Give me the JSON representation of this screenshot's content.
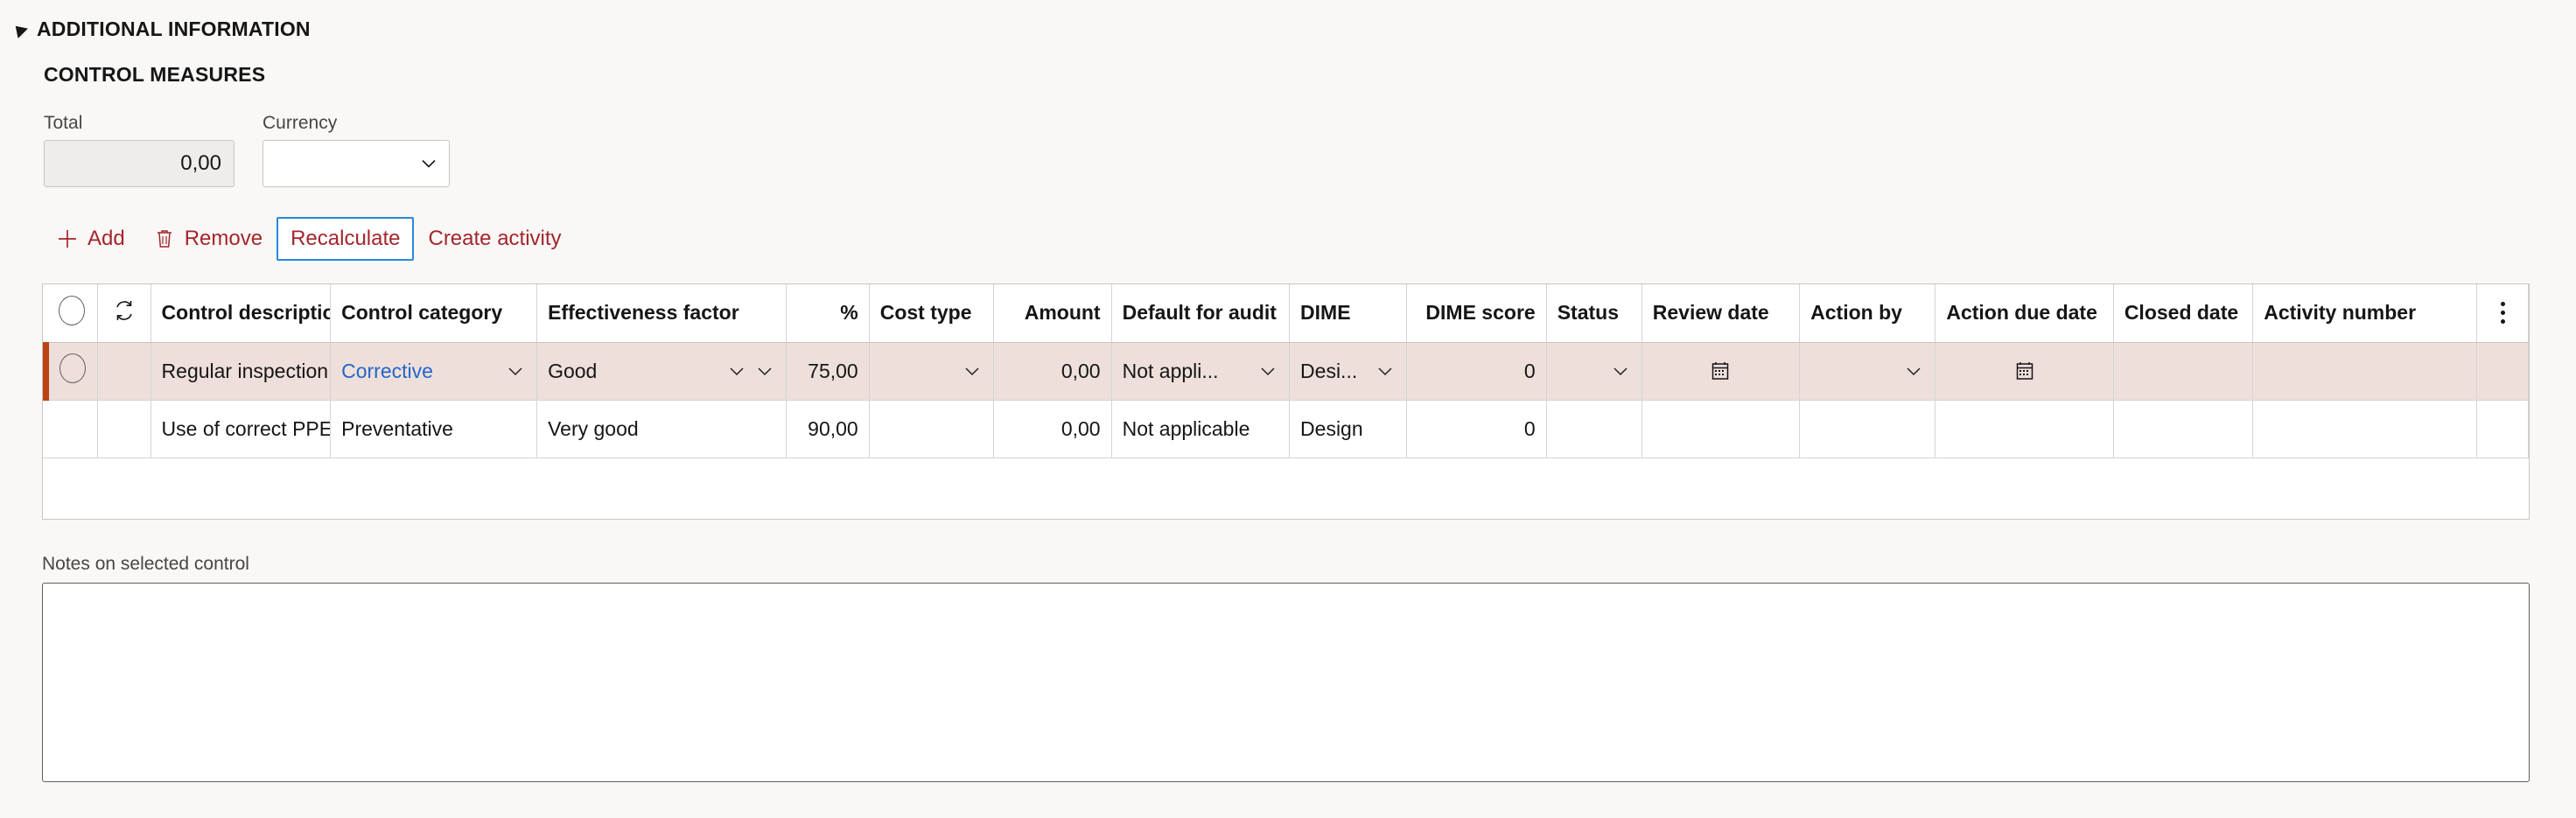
{
  "section": {
    "collapse_icon": "caret-down-icon",
    "title": "ADDITIONAL INFORMATION",
    "subtitle": "CONTROL MEASURES"
  },
  "fields": {
    "total": {
      "label": "Total",
      "value": "0,00"
    },
    "currency": {
      "label": "Currency",
      "value": "",
      "chevron_icon": "chevron-down-icon"
    }
  },
  "toolbar": {
    "add": {
      "label": "Add",
      "icon": "plus-icon"
    },
    "remove": {
      "label": "Remove",
      "icon": "trash-icon"
    },
    "recalculate": {
      "label": "Recalculate"
    },
    "create_activity": {
      "label": "Create activity"
    },
    "accent_color": "#a4262c",
    "focus_color": "#2b88d8"
  },
  "grid": {
    "select_all_icon": "radio-circle-icon",
    "refresh_icon": "sync-refresh-icon",
    "overflow_icon": "kebab-menu-icon",
    "headers": [
      "Control description",
      "Control category",
      "Effectiveness factor",
      "%",
      "Cost type",
      "Amount",
      "Default for audit",
      "DIME",
      "DIME score",
      "Status",
      "Review date",
      "Action by",
      "Action due date",
      "Closed date",
      "Activity number"
    ],
    "selected_row_color": "#eedfda",
    "selected_marker_color": "#bb4314",
    "rows": [
      {
        "selected": true,
        "control_description": "Regular inspection ...",
        "control_category": "Corrective",
        "control_category_is_link": true,
        "effectiveness_factor": "Good",
        "percent": "75,00",
        "cost_type": "",
        "amount": "0,00",
        "default_for_audit": "Not appli...",
        "dime": "Desi...",
        "dime_score": "0",
        "status": "",
        "review_date": "",
        "action_by": "",
        "action_due_date": "",
        "closed_date": "",
        "activity_number": ""
      },
      {
        "selected": false,
        "control_description": "Use of correct PPE",
        "control_category": "Preventative",
        "control_category_is_link": false,
        "effectiveness_factor": "Very good",
        "percent": "90,00",
        "cost_type": "",
        "amount": "0,00",
        "default_for_audit": "Not applicable",
        "dime": "Design",
        "dime_score": "0",
        "status": "",
        "review_date": "",
        "action_by": "",
        "action_due_date": "",
        "closed_date": "",
        "activity_number": ""
      }
    ]
  },
  "notes": {
    "label": "Notes on selected control",
    "value": "",
    "placeholder": ""
  }
}
